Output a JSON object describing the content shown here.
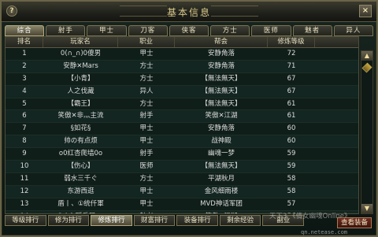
{
  "window": {
    "title": "基本信息",
    "help_icon": "?",
    "close_icon": "×"
  },
  "tabs": [
    "综合",
    "射手",
    "甲士",
    "刀客",
    "侠客",
    "方士",
    "医师",
    "魅者",
    "异人"
  ],
  "table": {
    "headers": [
      "排名",
      "玩家名",
      "职业",
      "帮会",
      "修炼等级"
    ],
    "rows": [
      [
        "1",
        "0(∩_∩)0傻男",
        "甲士",
        "安静角落",
        "72"
      ],
      [
        "2",
        "安静✕Mars",
        "方士",
        "安静角落",
        "71"
      ],
      [
        "3",
        "【小青】",
        "方士",
        "【無法無天】",
        "67"
      ],
      [
        "4",
        "人之伐藏",
        "异人",
        "【無法無天】",
        "67"
      ],
      [
        "5",
        "【霸王】",
        "方士",
        "【無法無天】",
        "61"
      ],
      [
        "6",
        "笑傲✕非灬主流",
        "射手",
        "笑傲✕江湖",
        "61"
      ],
      [
        "7",
        "§如花§",
        "甲士",
        "安静角落",
        "60"
      ],
      [
        "8",
        "帅の有点烦",
        "甲士",
        "战神殿",
        "60"
      ],
      [
        "9",
        "o0红杏爬墙0o",
        "射手",
        "幽魂一梦",
        "59"
      ],
      [
        "10",
        "【伤心】",
        "医师",
        "【無法無天】",
        "59"
      ],
      [
        "11",
        "弱水三千ぐ",
        "方士",
        "平湖秋月",
        "58"
      ],
      [
        "12",
        "东游西逛",
        "甲士",
        "金风细雨楼",
        "58"
      ],
      [
        "13",
        "盾丨、①统仟軍",
        "甲士",
        "MVD神话军团",
        "57"
      ],
      [
        "14",
        "8く么隱兵器σκ",
        "魅者",
        "笑傲✕江湖",
        "56"
      ]
    ]
  },
  "bottom_tabs": [
    "等级排行",
    "修为排行",
    "修炼排行",
    "财富排行",
    "装备排行",
    "剩余经验",
    "副业"
  ],
  "active_bottom": 2,
  "view_button": "查看装备",
  "watermark": "天下3 《倩女幽魂Online》",
  "url": "qn.netease.com",
  "colors": {
    "accent": "#b3a978",
    "title": "#d9c98a"
  }
}
